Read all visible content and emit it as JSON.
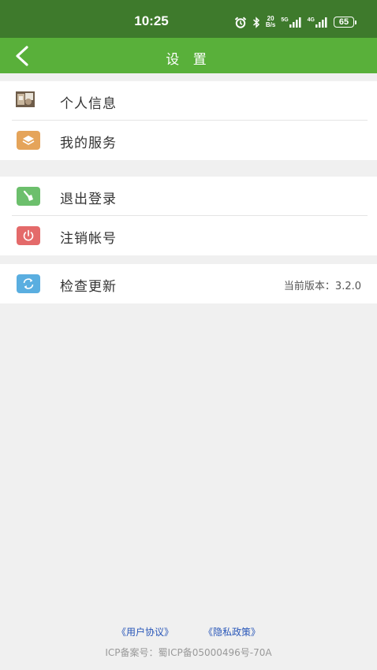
{
  "status_bar": {
    "time": "10:25",
    "net_speed_value": "20",
    "net_speed_unit": "B/s",
    "signal1_label": "5G",
    "signal2_label": "4G",
    "battery": "65",
    "icons": [
      "alarm-icon",
      "bluetooth-icon",
      "signal-icon",
      "battery-icon"
    ]
  },
  "header": {
    "title": "设 置",
    "back_icon": "chevron-left-icon"
  },
  "groups": [
    {
      "items": [
        {
          "label": "个人信息",
          "icon": "avatar-icon"
        },
        {
          "label": "我的服务",
          "icon": "layers-icon",
          "icon_color": "#e5a45a"
        }
      ]
    },
    {
      "items": [
        {
          "label": "退出登录",
          "icon": "broom-icon",
          "icon_color": "#6cbf6c"
        },
        {
          "label": "注销帐号",
          "icon": "power-icon",
          "icon_color": "#e46a6a"
        }
      ]
    },
    {
      "items": [
        {
          "label": "检查更新",
          "icon": "refresh-icon",
          "icon_color": "#5aaee0",
          "value": "当前版本：3.2.0"
        }
      ]
    }
  ],
  "footer": {
    "user_agreement": "《用户协议》",
    "privacy_policy": "《隐私政策》",
    "icp": "ICP备案号：蜀ICP备05000496号-70A"
  },
  "colors": {
    "status_bar_bg": "#3e7a2c",
    "header_bg": "#59b03a",
    "page_bg": "#f0f0f0",
    "link": "#2856b8"
  }
}
